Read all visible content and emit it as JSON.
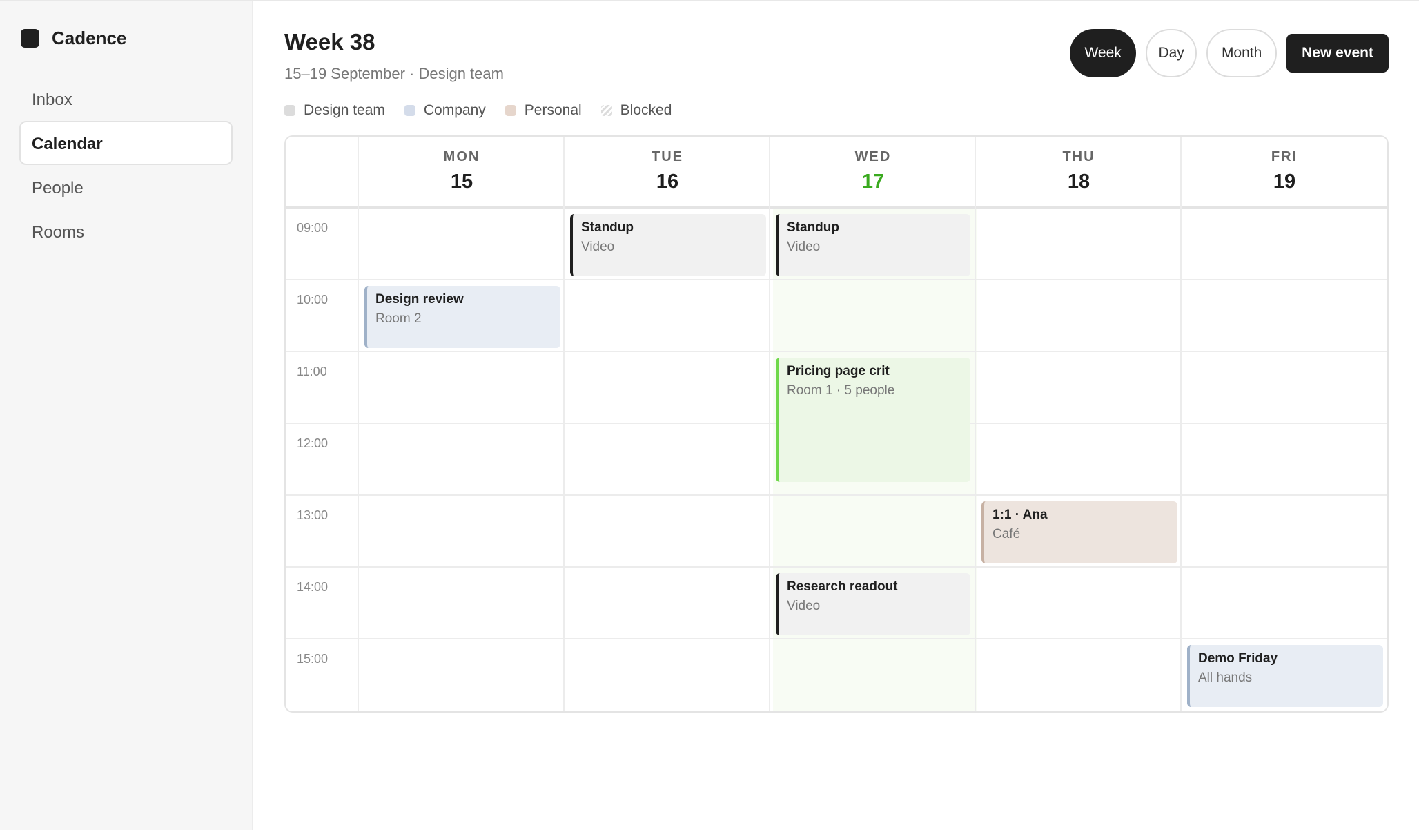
{
  "sidebar": {
    "brand": "Cadence",
    "items": [
      {
        "label": "Inbox"
      },
      {
        "label": "Calendar"
      },
      {
        "label": "People"
      },
      {
        "label": "Rooms"
      }
    ]
  },
  "header": {
    "title": "Week 38",
    "subtitle": "15–19 September · Design team"
  },
  "views": {
    "week": "Week",
    "day": "Day",
    "month": "Month",
    "new_event": "New event"
  },
  "legend": [
    {
      "label": "Design team",
      "color": "#dcdcdc"
    },
    {
      "label": "Company",
      "color": "#d4dcea"
    },
    {
      "label": "Personal",
      "color": "#e6d6cc"
    },
    {
      "label": "Blocked",
      "color": "striped"
    }
  ],
  "days": [
    {
      "name": "MON",
      "num": "15"
    },
    {
      "name": "TUE",
      "num": "16"
    },
    {
      "name": "WED",
      "num": "17",
      "today": true
    },
    {
      "name": "THU",
      "num": "18"
    },
    {
      "name": "FRI",
      "num": "19"
    }
  ],
  "times": [
    "09:00",
    "10:00",
    "11:00",
    "12:00",
    "13:00",
    "14:00",
    "15:00"
  ],
  "events": [
    {
      "title": "Standup",
      "sub": "Video"
    },
    {
      "title": "Standup",
      "sub": "Video"
    },
    {
      "title": "Design review",
      "sub": "Room 2"
    },
    {
      "title": "Pricing page crit",
      "sub": "Room 1 · 5 people"
    },
    {
      "title": "1:1 · Ana",
      "sub": "Café"
    },
    {
      "title": "Research readout",
      "sub": "Video"
    },
    {
      "title": "Demo Friday",
      "sub": "All hands"
    }
  ]
}
